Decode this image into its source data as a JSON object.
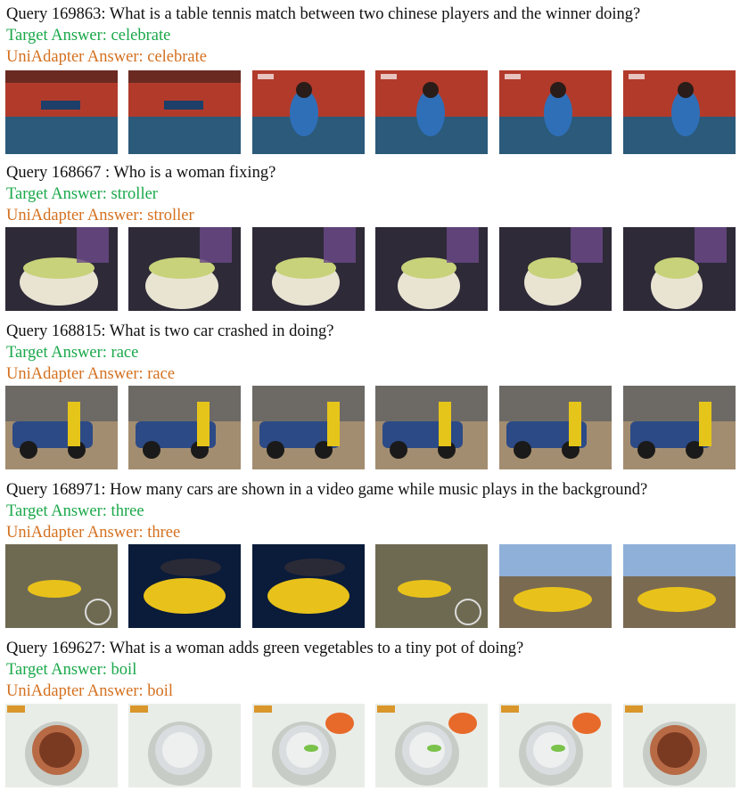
{
  "items": [
    {
      "query": "Query 169863: What is a table tennis match between two chinese players and the winner doing?",
      "target": "Target Answer: celebrate",
      "pred": "UniAdapter Answer: celebrate",
      "scene": "table-tennis",
      "colors": {
        "bg": "#b23a2a",
        "floor": "#2b5a7a",
        "accent": "#2f6fb8",
        "fg": "#e8e2d8"
      }
    },
    {
      "query": "Query 168667 : Who is a woman fixing?",
      "target": "Target Answer: stroller",
      "pred": "UniAdapter Answer: stroller",
      "scene": "stroller",
      "colors": {
        "bg": "#3a2b40",
        "floor": "#c8d27a",
        "accent": "#e9e4d2",
        "fg": "#6b4a8a"
      }
    },
    {
      "query": "Query 168815: What is two car crashed in doing?",
      "target": "Target Answer: race",
      "pred": "UniAdapter Answer: race",
      "scene": "car-crash",
      "colors": {
        "bg": "#8d7a62",
        "floor": "#a38d70",
        "accent": "#2c4a86",
        "fg": "#e6c51a"
      }
    },
    {
      "query": "Query 168971: How many cars are shown in a video game while music plays in the background?",
      "target": "Target Answer: three",
      "pred": "UniAdapter Answer: three",
      "scene": "video-game",
      "colors": {
        "bg": "#5a5a46",
        "floor": "#6e6a52",
        "accent": "#e8c21a",
        "fg": "#203a6a"
      }
    },
    {
      "query": "Query 169627: What is a woman adds green vegetables to a tiny pot of doing?",
      "target": "Target Answer: boil",
      "pred": "UniAdapter Answer: boil",
      "scene": "cooking",
      "colors": {
        "bg": "#e9ede7",
        "floor": "#d8ddd5",
        "accent": "#b0563a",
        "fg": "#7ac24a"
      }
    }
  ]
}
